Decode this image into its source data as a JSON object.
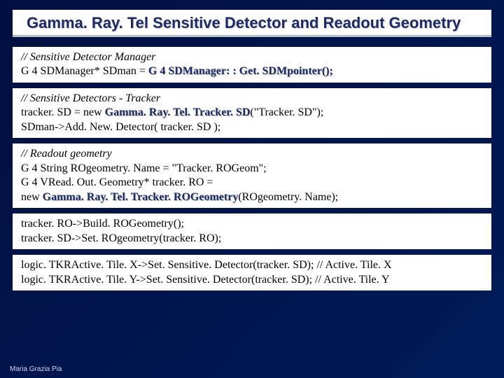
{
  "title": "Gamma. Ray. Tel Sensitive Detector and Readout Geometry",
  "block1": {
    "comment": "// Sensitive Detector Manager",
    "l1_pre": " G 4 SDManager* SDman = ",
    "l1_hl": "G 4 SDManager: : Get. SDMpointer();"
  },
  "block2": {
    "comment": "// Sensitive Detectors - Tracker",
    "l1_pre": "  tracker. SD = new ",
    "l1_hl": "Gamma. Ray. Tel. Tracker. SD",
    "l1_post": "(\"Tracker. SD\");",
    "l2": "  SDman->Add. New. Detector( tracker. SD );"
  },
  "block3": {
    "comment": "// Readout geometry",
    "l1": " G 4 String ROgeometry. Name = \"Tracker. ROGeom\";",
    "l2": " G 4 VRead. Out. Geometry* tracker. RO =",
    "l3_pre": "  new ",
    "l3_hl": "Gamma. Ray. Tel. Tracker. ROGeometry",
    "l3_post": "(ROgeometry. Name);"
  },
  "block4": {
    "l1": " tracker. RO->Build. ROGeometry();",
    "l2": " tracker. SD->Set. ROgeometry(tracker. RO);"
  },
  "block5": {
    "l1": " logic. TKRActive. Tile. X->Set. Sensitive. Detector(tracker. SD); // Active. Tile. X",
    "l2": " logic. TKRActive. Tile. Y->Set. Sensitive. Detector(tracker. SD); // Active. Tile. Y"
  },
  "footer": "Maria Grazia Pia"
}
